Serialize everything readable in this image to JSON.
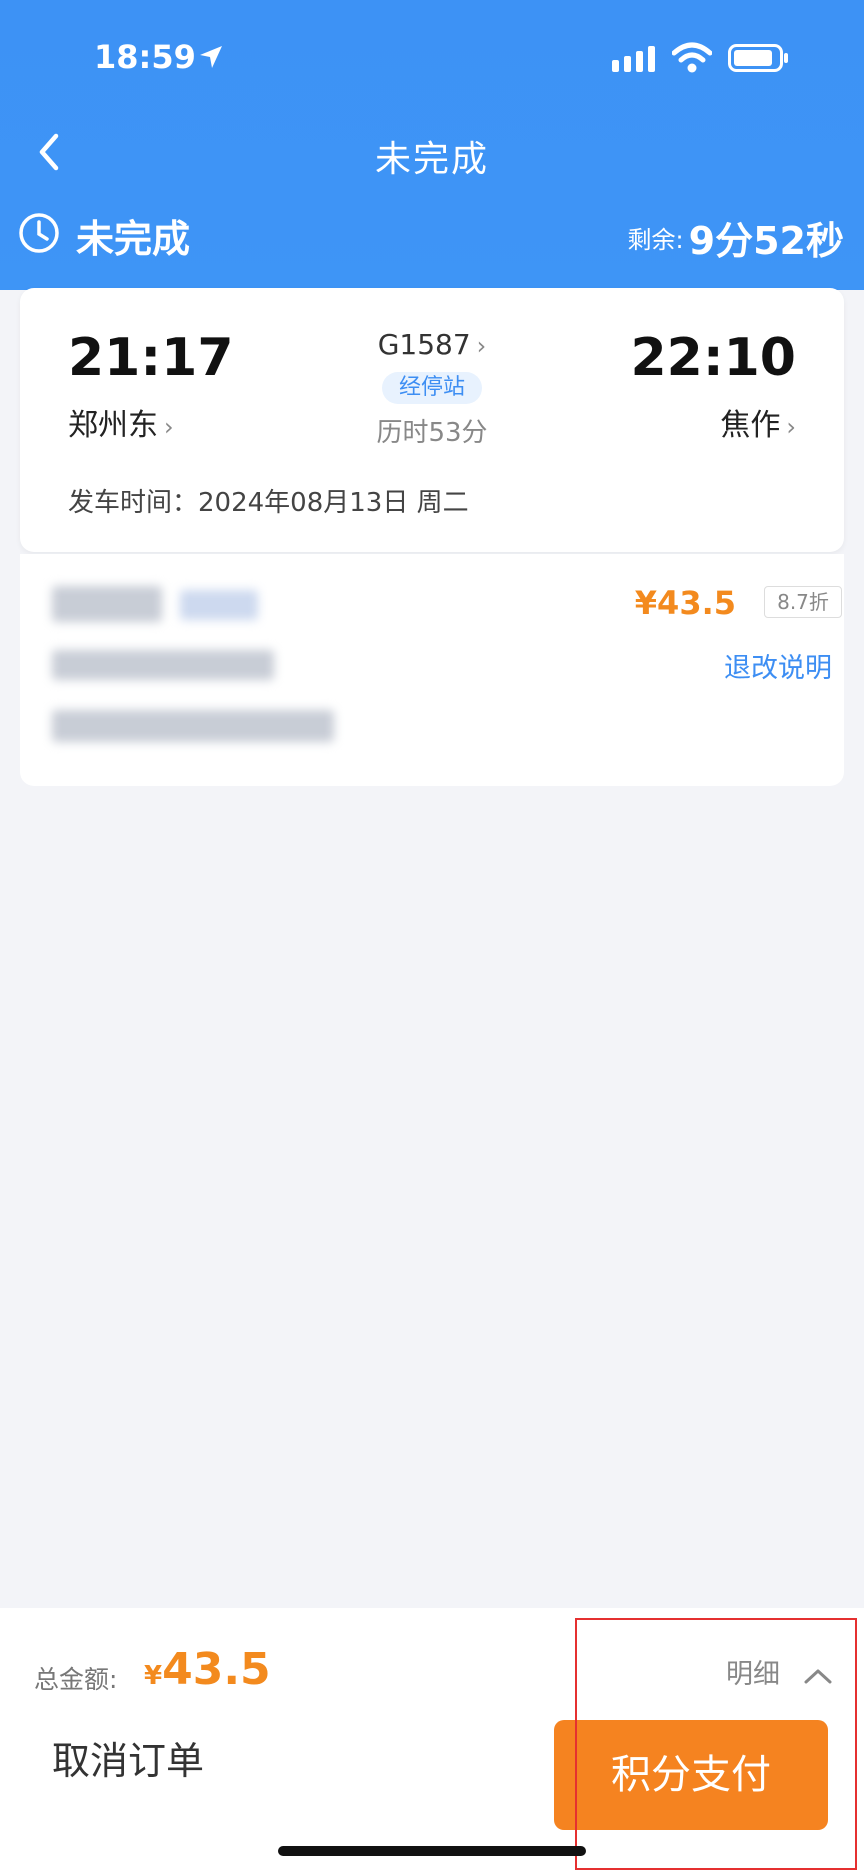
{
  "status_bar": {
    "time": "18:59"
  },
  "nav": {
    "title": "未完成"
  },
  "order_status": {
    "label": "未完成",
    "remaining_label": "剩余:",
    "remaining_value": "9分52秒"
  },
  "trip": {
    "departure_time": "21:17",
    "departure_station": "郑州东",
    "arrival_time": "22:10",
    "arrival_station": "焦作",
    "train_number": "G1587",
    "stops_label": "经停站",
    "duration": "历时53分",
    "departure_date": "发车时间：2024年08月13日 周二"
  },
  "ticket": {
    "price": "¥43.5",
    "discount": "8.7折",
    "refund_link": "退改说明"
  },
  "footer": {
    "total_label": "总金额:",
    "total_currency": "¥",
    "total_amount": "43.5",
    "detail_label": "明细",
    "cancel_label": "取消订单",
    "pay_label": "积分支付"
  },
  "colors": {
    "header_blue": "#3d92f5",
    "accent_orange": "#f58320",
    "link_blue": "#3d8ef3",
    "highlight_red": "#e53030"
  }
}
